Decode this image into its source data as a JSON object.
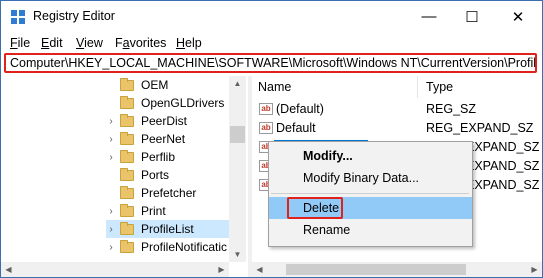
{
  "window": {
    "title": "Registry Editor",
    "controls": {
      "minimize": "—",
      "maximize": "☐",
      "close": "✕"
    }
  },
  "menu": {
    "items": [
      "File",
      "Edit",
      "View",
      "Favorites",
      "Help"
    ],
    "mnemonics": [
      "F",
      "E",
      "V",
      "a",
      "H"
    ],
    "rests": [
      "ile",
      "dit",
      "iew",
      "vorites",
      "elp"
    ],
    "prefixes": [
      "",
      "",
      "",
      "F",
      ""
    ]
  },
  "address": {
    "path": "Computer\\HKEY_LOCAL_MACHINE\\SOFTWARE\\Microsoft\\Windows NT\\CurrentVersion\\ProfileList"
  },
  "tree": {
    "items": [
      {
        "label": "OEM",
        "expandable": false
      },
      {
        "label": "OpenGLDrivers",
        "expandable": false
      },
      {
        "label": "PeerDist",
        "expandable": true
      },
      {
        "label": "PeerNet",
        "expandable": true
      },
      {
        "label": "Perflib",
        "expandable": true
      },
      {
        "label": "Ports",
        "expandable": false
      },
      {
        "label": "Prefetcher",
        "expandable": false
      },
      {
        "label": "Print",
        "expandable": true
      },
      {
        "label": "ProfileList",
        "expandable": true,
        "selected": true
      },
      {
        "label": "ProfileNotificatic",
        "expandable": true
      }
    ]
  },
  "values": {
    "columns": {
      "name": "Name",
      "type": "Type"
    },
    "rows": [
      {
        "name": "(Default)",
        "type": "REG_SZ"
      },
      {
        "name": "Default",
        "type": "REG_EXPAND_SZ"
      },
      {
        "name": "",
        "type": "EXPAND_SZ"
      },
      {
        "name": "",
        "type": "EXPAND_SZ"
      },
      {
        "name": "",
        "type": "EXPAND_SZ"
      }
    ]
  },
  "context_menu": {
    "items": [
      "Modify...",
      "Modify Binary Data...",
      "Delete",
      "Rename"
    ],
    "hovered": "Delete",
    "default_item": "Modify..."
  },
  "colors": {
    "highlight_box": "#e0221e",
    "hover": "#91c9f7",
    "selection": "#cce8ff"
  }
}
